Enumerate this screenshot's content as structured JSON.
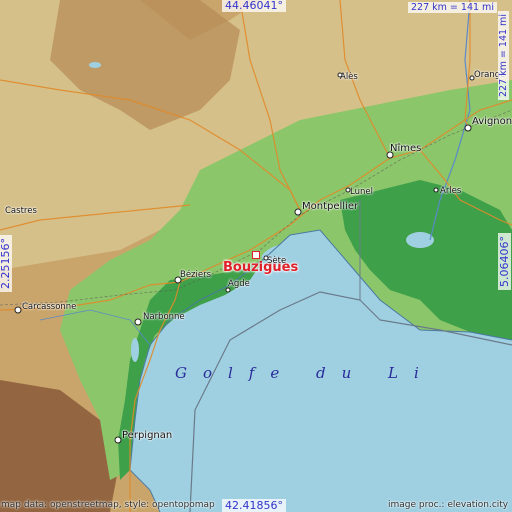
{
  "coordinates": {
    "top": "44.46041°",
    "bottom": "42.41856°",
    "left": "2.25156°",
    "right": "5.06406°"
  },
  "scale": {
    "top": "227 km = 141 mi",
    "right": "227 km = 141 mi"
  },
  "highlight_city": "Bouzigues",
  "cities": {
    "ales": "Alès",
    "orange": "Orange",
    "avignon": "Avignon",
    "nimes": "Nîmes",
    "lunel": "Lunel",
    "arles": "Arles",
    "montpellier": "Montpellier",
    "sete": "Sète",
    "castres": "Castres",
    "beziers": "Béziers",
    "agde": "Agde",
    "carcassonne": "Carcassonne",
    "narbonne": "Narbonne",
    "perpignan": "Perpignan"
  },
  "sea_label": "Golfe du Li",
  "credits": {
    "left": "map data: openstreetmap, style: opentopomap",
    "right": "image proc.: elevation.city"
  },
  "colors": {
    "sea": "#9fd0e2",
    "lowland": "#3fa04a",
    "plain": "#8cc66a",
    "hills": "#d9c890",
    "highlands": "#c7a06a",
    "mountains": "#8a5a3a",
    "highlight": "#e0202a",
    "coordinate_text": "#3333cc"
  }
}
